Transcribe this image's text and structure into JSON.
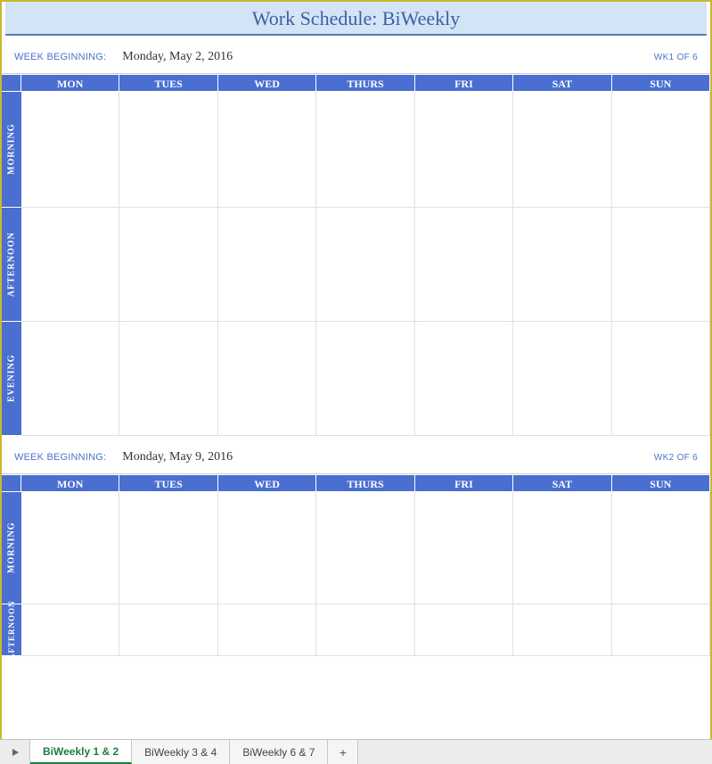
{
  "title": "Work Schedule: BiWeekly",
  "weekBeginningLabel": "WEEK BEGINNING:",
  "dayHeaders": [
    "MON",
    "TUES",
    "WED",
    "THURS",
    "FRI",
    "SAT",
    "SUN"
  ],
  "periods": [
    "MORNING",
    "AFTERNOON",
    "EVENING"
  ],
  "weeks": [
    {
      "date": "Monday, May 2, 2016",
      "wkOf": "WK1 OF 6",
      "visiblePeriods": 3
    },
    {
      "date": "Monday, May 9, 2016",
      "wkOf": "WK2 OF 6",
      "visiblePeriods": 2
    }
  ],
  "tabs": {
    "items": [
      "BiWeekly 1 & 2",
      "BiWeekly 3 & 4",
      "BiWeekly 6 & 7"
    ],
    "activeIndex": 0,
    "addLabel": "+"
  }
}
